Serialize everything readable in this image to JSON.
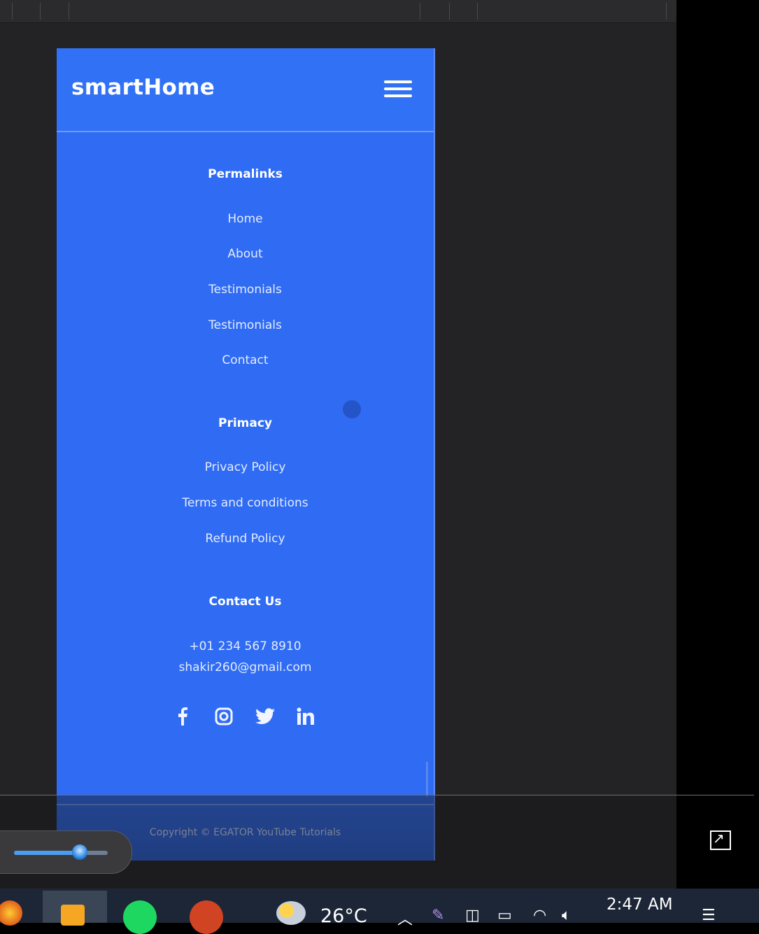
{
  "app": {
    "brand": "smartHome"
  },
  "footer": {
    "permalinks": {
      "title": "Permalinks",
      "links": [
        "Home",
        "About",
        "Testimonials",
        "Testimonials",
        "Contact"
      ]
    },
    "primacy": {
      "title": "Primacy",
      "links": [
        "Privacy Policy",
        "Terms and conditions",
        "Refund Policy"
      ]
    },
    "contact": {
      "title": "Contact Us",
      "phone": "+01 234 567 8910",
      "email": "shakir260@gmail.com"
    },
    "social": [
      "facebook-icon",
      "instagram-icon",
      "twitter-icon",
      "linkedin-icon"
    ],
    "copyright": "Copyright © EGATOR YouTube Tutorials"
  },
  "player": {
    "volume": 0.7
  },
  "taskbar": {
    "temperature": "26°C",
    "time": "2:47 AM"
  },
  "colors": {
    "accent": "#2f6cf3",
    "taskbar": "#1c2636"
  }
}
